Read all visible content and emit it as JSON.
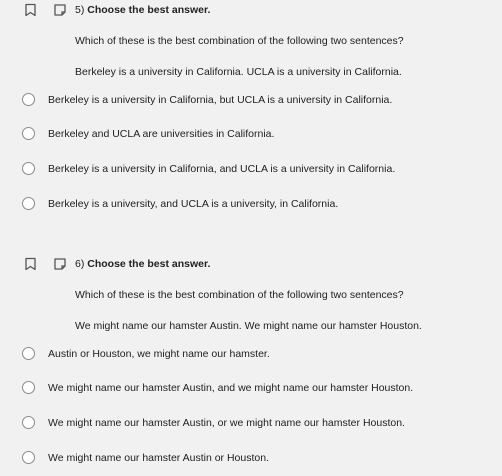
{
  "questions": [
    {
      "number": "5)",
      "title": "Choose the best answer.",
      "prompt": "Which of these is the best combination of the following two sentences?",
      "sentences": "Berkeley is a university in California. UCLA is a university in California.",
      "options": [
        "Berkeley is a university in California, but UCLA is a university in California.",
        "Berkeley and UCLA are universities in California.",
        "Berkeley is a university in California, and UCLA is a university in California.",
        "Berkeley is a university, and UCLA is a university, in California."
      ]
    },
    {
      "number": "6)",
      "title": "Choose the best answer.",
      "prompt": "Which of these is the best combination of the following two sentences?",
      "sentences": "We might name our hamster Austin. We might name our hamster Houston.",
      "options": [
        "Austin or Houston, we might name our hamster.",
        "We might name our hamster Austin, and we might name our hamster Houston.",
        "We might name our hamster Austin, or we might name our hamster Houston.",
        "We might name our hamster Austin or Houston."
      ]
    }
  ],
  "icons": {
    "bookmark": "bookmark-icon",
    "flag": "flag-icon"
  }
}
